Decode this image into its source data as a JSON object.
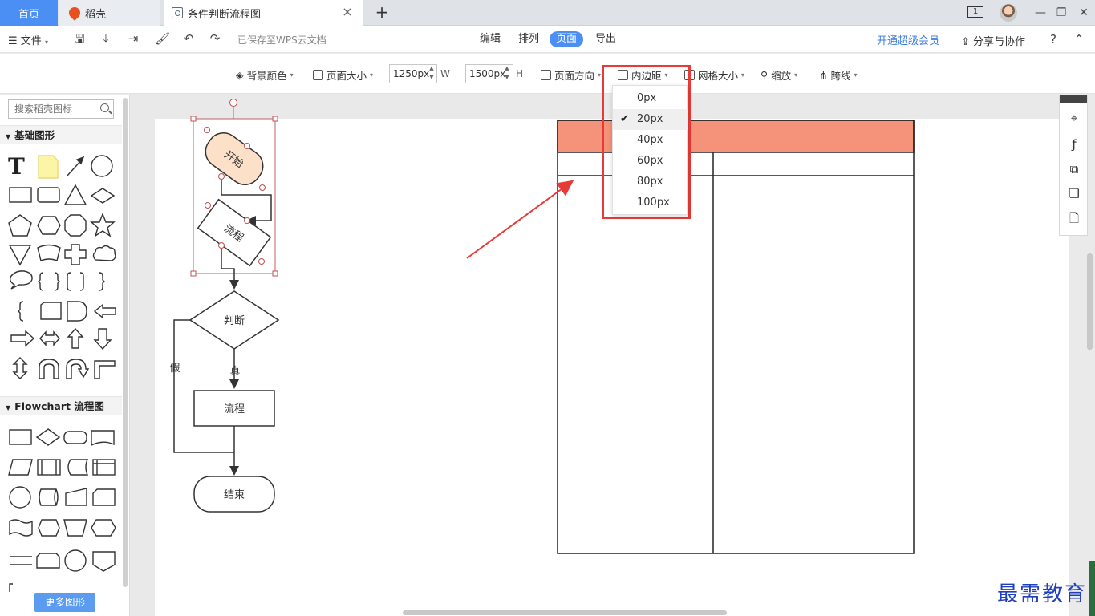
{
  "tabs": {
    "home": "首页",
    "daoke": "稻壳",
    "doc": "条件判断流程图",
    "count_badge": "1"
  },
  "menubar": {
    "file": "文件",
    "saved_status": "已保存至WPS云文档",
    "modes": [
      "编辑",
      "排列",
      "页面",
      "导出"
    ],
    "active_mode": "页面",
    "vip": "开通超级会员",
    "share": "分享与协作",
    "help": "?"
  },
  "toolbar": {
    "bg_color": "背景颜色",
    "page_size": "页面大小",
    "width_value": "1250px",
    "width_unit": "W",
    "height_value": "1500px",
    "height_unit": "H",
    "orientation": "页面方向",
    "padding": "内边距",
    "grid_size": "网格大小",
    "zoom": "缩放",
    "jump_line": "跨线"
  },
  "padding_dropdown": {
    "options": [
      "0px",
      "20px",
      "40px",
      "60px",
      "80px",
      "100px"
    ],
    "selected": "20px"
  },
  "sidebar": {
    "search_placeholder": "搜索稻壳图标",
    "section_basic": "基础图形",
    "section_flowchart": "Flowchart 流程图",
    "more_shapes": "更多图形"
  },
  "flowchart": {
    "start": "开始",
    "process1": "流程",
    "decision": "判断",
    "false_label": "假",
    "true_label": "真",
    "process2": "流程",
    "end": "结束"
  },
  "colors": {
    "accent": "#4b8ff5",
    "highlight_red": "#e83a36",
    "start_fill": "#fde0c8",
    "table_header": "#f4927a"
  },
  "watermark": "最需教育"
}
